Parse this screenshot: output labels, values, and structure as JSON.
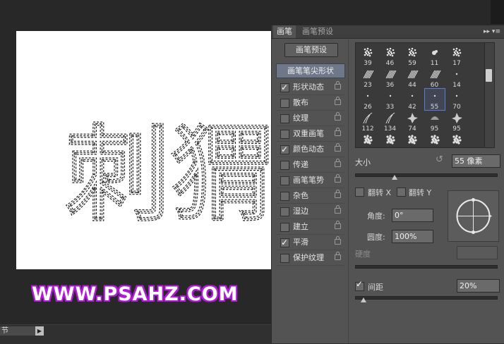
{
  "canvas": {
    "selection_text": "刺猬",
    "watermark": "WWW.PSAHZ.COM"
  },
  "bottom_bar": {
    "field_text": "节",
    "arrow_icon": "play-arrow-icon"
  },
  "panel": {
    "tabs": [
      {
        "label": "画笔",
        "active": true
      },
      {
        "label": "画笔预设",
        "active": false
      }
    ],
    "menu_icon": "▸▸ ▾≡",
    "presets_button": "画笔预设",
    "brush_tip_shape": "画笔笔尖形状",
    "options": [
      {
        "label": "形状动态",
        "checked": true
      },
      {
        "label": "散布",
        "checked": false
      },
      {
        "label": "纹理",
        "checked": false
      },
      {
        "label": "双重画笔",
        "checked": false
      },
      {
        "label": "颜色动态",
        "checked": true
      },
      {
        "label": "传递",
        "checked": false
      },
      {
        "label": "画笔笔势",
        "checked": false
      },
      {
        "label": "杂色",
        "checked": false
      },
      {
        "label": "湿边",
        "checked": false
      },
      {
        "label": "建立",
        "checked": false
      },
      {
        "label": "平滑",
        "checked": true
      },
      {
        "label": "保护纹理",
        "checked": false
      }
    ],
    "brush_grid": [
      {
        "size": "39",
        "tip": "splatter"
      },
      {
        "size": "46",
        "tip": "splatter"
      },
      {
        "size": "59",
        "tip": "splatter"
      },
      {
        "size": "11",
        "tip": "small-blob"
      },
      {
        "size": "17",
        "tip": "splatter"
      },
      {
        "size": "23",
        "tip": "bristle"
      },
      {
        "size": "36",
        "tip": "bristle"
      },
      {
        "size": "44",
        "tip": "bristle"
      },
      {
        "size": "60",
        "tip": "bristle"
      },
      {
        "size": "14",
        "tip": "dot"
      },
      {
        "size": "26",
        "tip": "dot"
      },
      {
        "size": "33",
        "tip": "dot"
      },
      {
        "size": "42",
        "tip": "dot"
      },
      {
        "size": "55",
        "tip": "dot",
        "selected": true
      },
      {
        "size": "70",
        "tip": "dot"
      },
      {
        "size": "112",
        "tip": "grass"
      },
      {
        "size": "134",
        "tip": "grass"
      },
      {
        "size": "74",
        "tip": "leaf"
      },
      {
        "size": "95",
        "tip": "round"
      },
      {
        "size": "95",
        "tip": "leaf"
      },
      {
        "size": "",
        "tip": "texture"
      },
      {
        "size": "",
        "tip": "texture"
      },
      {
        "size": "",
        "tip": "texture"
      },
      {
        "size": "",
        "tip": "texture"
      },
      {
        "size": "",
        "tip": "texture"
      }
    ],
    "size_label": "大小",
    "size_value": "55 像素",
    "size_slider_fraction": 0.28,
    "flip_x_label": "翻转 X",
    "flip_y_label": "翻转 Y",
    "flip_x_checked": false,
    "flip_y_checked": false,
    "angle_label": "角度:",
    "angle_value": "0°",
    "roundness_label": "圆度:",
    "roundness_value": "100%",
    "hardness_label": "硬度",
    "spacing_label": "间距",
    "spacing_checked": true,
    "spacing_value": "20%",
    "spacing_slider_fraction": 0.06
  }
}
